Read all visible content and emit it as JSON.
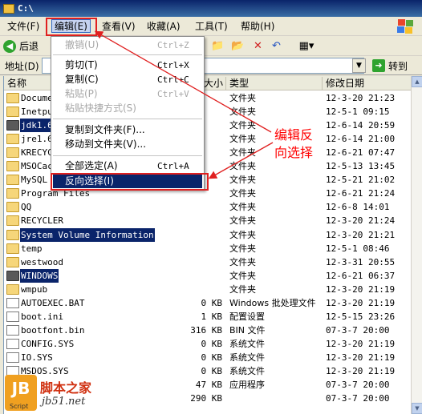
{
  "window": {
    "title": "C:\\"
  },
  "menubar": {
    "items": [
      "文件(F)",
      "编辑(E)",
      "查看(V)",
      "收藏(A)",
      "工具(T)",
      "帮助(H)"
    ]
  },
  "toolbar": {
    "back_label": "后退"
  },
  "addressbar": {
    "label": "地址(D)",
    "value": "",
    "go_label": "转到"
  },
  "columns": {
    "name": "名称",
    "size": "大小",
    "type": "类型",
    "modified": "修改日期"
  },
  "files": [
    {
      "name": "Documents and Settings",
      "size": "",
      "type": "文件夹",
      "date": "12-3-20 21:23",
      "icon": "folder"
    },
    {
      "name": "Inetpub",
      "size": "",
      "type": "文件夹",
      "date": "12-5-1 09:15",
      "icon": "folder"
    },
    {
      "name": "jdk1.6",
      "size": "",
      "type": "文件夹",
      "date": "12-6-14 20:59",
      "icon": "folder-dark"
    },
    {
      "name": "jre1.6",
      "size": "",
      "type": "文件夹",
      "date": "12-6-14 21:00",
      "icon": "folder"
    },
    {
      "name": "KRECYCLE",
      "size": "",
      "type": "文件夹",
      "date": "12-6-21 07:47",
      "icon": "folder"
    },
    {
      "name": "MSOCache",
      "size": "",
      "type": "文件夹",
      "date": "12-5-13 13:45",
      "icon": "folder"
    },
    {
      "name": "MySQL",
      "size": "",
      "type": "文件夹",
      "date": "12-5-21 21:02",
      "icon": "folder"
    },
    {
      "name": "Program Files",
      "size": "",
      "type": "文件夹",
      "date": "12-6-21 21:24",
      "icon": "folder"
    },
    {
      "name": "QQ",
      "size": "",
      "type": "文件夹",
      "date": "12-6-8 14:01",
      "icon": "folder"
    },
    {
      "name": "RECYCLER",
      "size": "",
      "type": "文件夹",
      "date": "12-3-20 21:24",
      "icon": "folder"
    },
    {
      "name": "System Volume Information",
      "size": "",
      "type": "文件夹",
      "date": "12-3-20 21:21",
      "icon": "folder"
    },
    {
      "name": "temp",
      "size": "",
      "type": "文件夹",
      "date": "12-5-1 08:46",
      "icon": "folder"
    },
    {
      "name": "westwood",
      "size": "",
      "type": "文件夹",
      "date": "12-3-31 20:55",
      "icon": "folder"
    },
    {
      "name": "WINDOWS",
      "size": "",
      "type": "文件夹",
      "date": "12-6-21 06:37",
      "icon": "folder-dark"
    },
    {
      "name": "wmpub",
      "size": "",
      "type": "文件夹",
      "date": "12-3-20 21:19",
      "icon": "folder"
    },
    {
      "name": "AUTOEXEC.BAT",
      "size": "0 KB",
      "type": "Windows 批处理文件",
      "date": "12-3-20 21:19",
      "icon": "file"
    },
    {
      "name": "boot.ini",
      "size": "1 KB",
      "type": "配置设置",
      "date": "12-5-15 23:26",
      "icon": "file"
    },
    {
      "name": "bootfont.bin",
      "size": "316 KB",
      "type": "BIN 文件",
      "date": "07-3-7 20:00",
      "icon": "file"
    },
    {
      "name": "CONFIG.SYS",
      "size": "0 KB",
      "type": "系统文件",
      "date": "12-3-20 21:19",
      "icon": "file"
    },
    {
      "name": "IO.SYS",
      "size": "0 KB",
      "type": "系统文件",
      "date": "12-3-20 21:19",
      "icon": "file"
    },
    {
      "name": "MSDOS.SYS",
      "size": "0 KB",
      "type": "系统文件",
      "date": "12-3-20 21:19",
      "icon": "file"
    },
    {
      "name": "",
      "size": "47 KB",
      "type": "应用程序",
      "date": "07-3-7 20:00",
      "icon": "file"
    },
    {
      "name": "",
      "size": "290 KB",
      "type": "",
      "date": "07-3-7 20:00",
      "icon": "file"
    }
  ],
  "edit_menu": {
    "undo": "撤销(U)",
    "undo_sc": "Ctrl+Z",
    "cut": "剪切(T)",
    "cut_sc": "Ctrl+X",
    "copy": "复制(C)",
    "copy_sc": "Ctrl+C",
    "paste": "粘贴(P)",
    "paste_sc": "Ctrl+V",
    "paste_shortcut": "粘贴快捷方式(S)",
    "copy_to": "复制到文件夹(F)...",
    "move_to": "移动到文件夹(V)...",
    "select_all": "全部选定(A)",
    "select_all_sc": "Ctrl+A",
    "invert": "反向选择(I)"
  },
  "annotation": {
    "line1": "编辑反",
    "line2": "向选择"
  },
  "watermark": {
    "badge": "JB",
    "sub": "Script",
    "cn": "脚本之家",
    "en": "jb51.net"
  },
  "colors": {
    "accent": "#0a246a",
    "annotation": "#ff0000"
  }
}
